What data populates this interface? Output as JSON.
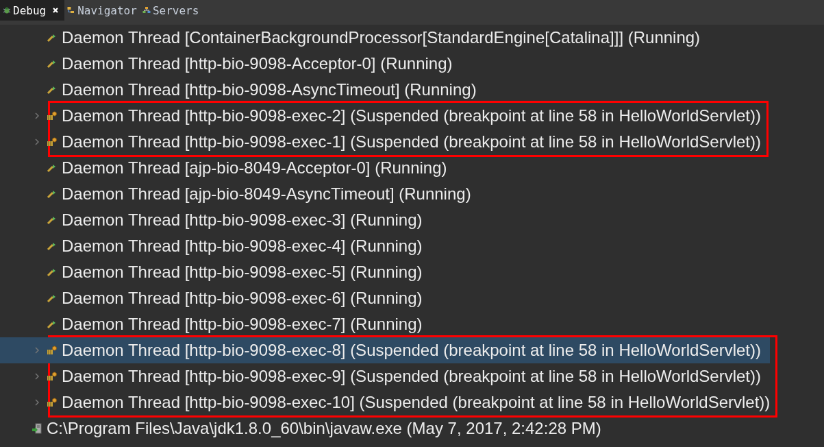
{
  "tabs": [
    {
      "label": "Debug",
      "selected": true,
      "closable": true
    },
    {
      "label": "Navigator",
      "selected": false,
      "closable": false
    },
    {
      "label": "Servers",
      "selected": false,
      "closable": false
    }
  ],
  "groups": [
    {
      "outlined": false,
      "threads": [
        {
          "label": "Daemon Thread [ContainerBackgroundProcessor[StandardEngine[Catalina]]] (Running)",
          "kind": "running",
          "selected": false
        },
        {
          "label": "Daemon Thread [http-bio-9098-Acceptor-0] (Running)",
          "kind": "running",
          "selected": false
        },
        {
          "label": "Daemon Thread [http-bio-9098-AsyncTimeout] (Running)",
          "kind": "running",
          "selected": false
        }
      ]
    },
    {
      "outlined": true,
      "threads": [
        {
          "label": "Daemon Thread [http-bio-9098-exec-2] (Suspended (breakpoint at line 58 in HelloWorldServlet))",
          "kind": "suspended",
          "selected": false
        },
        {
          "label": "Daemon Thread [http-bio-9098-exec-1] (Suspended (breakpoint at line 58 in HelloWorldServlet))",
          "kind": "suspended",
          "selected": false
        }
      ]
    },
    {
      "outlined": false,
      "threads": [
        {
          "label": "Daemon Thread [ajp-bio-8049-Acceptor-0] (Running)",
          "kind": "running",
          "selected": false
        },
        {
          "label": "Daemon Thread [ajp-bio-8049-AsyncTimeout] (Running)",
          "kind": "running",
          "selected": false
        },
        {
          "label": "Daemon Thread [http-bio-9098-exec-3] (Running)",
          "kind": "running",
          "selected": false
        },
        {
          "label": "Daemon Thread [http-bio-9098-exec-4] (Running)",
          "kind": "running",
          "selected": false
        },
        {
          "label": "Daemon Thread [http-bio-9098-exec-5] (Running)",
          "kind": "running",
          "selected": false
        },
        {
          "label": "Daemon Thread [http-bio-9098-exec-6] (Running)",
          "kind": "running",
          "selected": false
        },
        {
          "label": "Daemon Thread [http-bio-9098-exec-7] (Running)",
          "kind": "running",
          "selected": false
        }
      ]
    },
    {
      "outlined": true,
      "threads": [
        {
          "label": "Daemon Thread [http-bio-9098-exec-8] (Suspended (breakpoint at line 58 in HelloWorldServlet))",
          "kind": "suspended",
          "selected": true
        },
        {
          "label": "Daemon Thread [http-bio-9098-exec-9] (Suspended (breakpoint at line 58 in HelloWorldServlet))",
          "kind": "suspended",
          "selected": false
        },
        {
          "label": "Daemon Thread [http-bio-9098-exec-10] (Suspended (breakpoint at line 58 in HelloWorldServlet))",
          "kind": "suspended",
          "selected": false
        }
      ]
    }
  ],
  "process": {
    "label": "C:\\Program Files\\Java\\jdk1.8.0_60\\bin\\javaw.exe (May 7, 2017, 2:42:28 PM)"
  }
}
